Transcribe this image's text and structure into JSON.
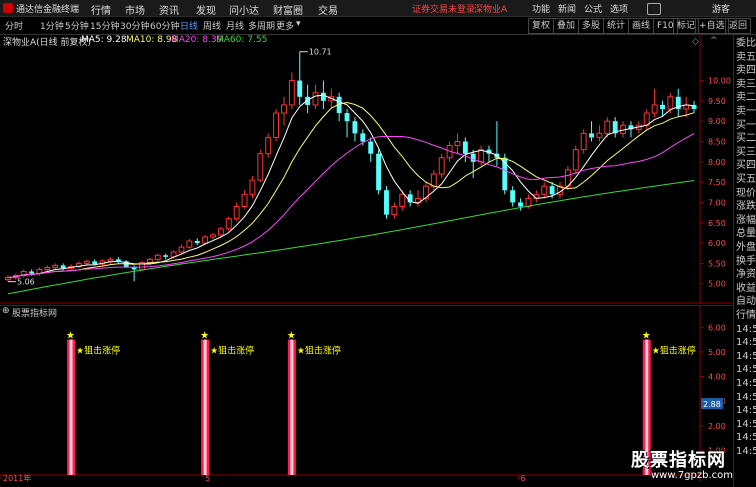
{
  "titlebar": {
    "app_name": "通达信金融终端",
    "menus": [
      "行情",
      "市场",
      "资讯",
      "发现",
      "问小达",
      "财富圈",
      "交易"
    ],
    "warning": "证券交易未登录",
    "stock": "深物业A",
    "right_items": [
      "功能",
      "新闻",
      "公式",
      "选项",
      "游客"
    ]
  },
  "toolbar": {
    "periods": [
      "分时",
      "1分钟",
      "5分钟",
      "15分钟",
      "30分钟",
      "60分钟",
      "日线",
      "周线",
      "月线",
      "多周期",
      "更多"
    ],
    "active": "日线",
    "right_buttons": [
      "复权",
      "叠加",
      "多股",
      "统计",
      "画线",
      "F10",
      "标记",
      "+自选",
      "返回"
    ]
  },
  "legend": {
    "title": "深物业A(日线 前复权)",
    "ma": [
      {
        "label": "MA5: 9.28",
        "color": "#ffffff"
      },
      {
        "label": "MA10: 8.98",
        "color": "#ffff66"
      },
      {
        "label": "MA20: 8.39",
        "color": "#ff44ff"
      },
      {
        "label": "MA60: 7.55",
        "color": "#33dd33"
      }
    ]
  },
  "price_axis": {
    "labels": [
      "10.00",
      "9.50",
      "9.00",
      "8.50",
      "8.00",
      "7.50",
      "7.00",
      "6.50",
      "6.00",
      "5.50",
      "5.00"
    ],
    "values": [
      10.0,
      9.5,
      9.0,
      8.5,
      8.0,
      7.5,
      7.0,
      6.5,
      6.0,
      5.5,
      5.0
    ]
  },
  "annotations": {
    "high": "10.71",
    "low": "5.06"
  },
  "chart_data": {
    "type": "candlestick",
    "ylim": [
      4.5,
      10.9
    ],
    "candles": [
      [
        5.1,
        5.15,
        5.05,
        5.2
      ],
      [
        5.15,
        5.2,
        5.1,
        5.25
      ],
      [
        5.2,
        5.3,
        5.15,
        5.35
      ],
      [
        5.3,
        5.25,
        5.2,
        5.35
      ],
      [
        5.25,
        5.35,
        5.2,
        5.4
      ],
      [
        5.35,
        5.4,
        5.28,
        5.45
      ],
      [
        5.4,
        5.45,
        5.35,
        5.5
      ],
      [
        5.45,
        5.38,
        5.33,
        5.5
      ],
      [
        5.38,
        5.42,
        5.3,
        5.48
      ],
      [
        5.42,
        5.5,
        5.38,
        5.55
      ],
      [
        5.5,
        5.55,
        5.45,
        5.6
      ],
      [
        5.55,
        5.48,
        5.44,
        5.6
      ],
      [
        5.48,
        5.56,
        5.44,
        5.6
      ],
      [
        5.56,
        5.6,
        5.5,
        5.65
      ],
      [
        5.6,
        5.55,
        5.5,
        5.66
      ],
      [
        5.55,
        5.4,
        5.38,
        5.58
      ],
      [
        5.4,
        5.35,
        5.06,
        5.45
      ],
      [
        5.35,
        5.52,
        5.33,
        5.56
      ],
      [
        5.52,
        5.6,
        5.48,
        5.64
      ],
      [
        5.6,
        5.7,
        5.56,
        5.74
      ],
      [
        5.7,
        5.66,
        5.6,
        5.74
      ],
      [
        5.66,
        5.78,
        5.62,
        5.82
      ],
      [
        5.78,
        5.9,
        5.74,
        5.96
      ],
      [
        5.9,
        6.05,
        5.86,
        6.1
      ],
      [
        6.05,
        6.0,
        5.95,
        6.12
      ],
      [
        6.0,
        6.15,
        5.96,
        6.2
      ],
      [
        6.15,
        6.2,
        6.08,
        6.25
      ],
      [
        6.2,
        6.35,
        6.15,
        6.4
      ],
      [
        6.35,
        6.6,
        6.3,
        6.65
      ],
      [
        6.6,
        6.9,
        6.55,
        7.0
      ],
      [
        6.9,
        7.2,
        6.85,
        7.3
      ],
      [
        7.2,
        7.55,
        7.1,
        7.65
      ],
      [
        7.55,
        8.2,
        7.5,
        8.3
      ],
      [
        8.2,
        8.6,
        8.1,
        8.7
      ],
      [
        8.6,
        9.2,
        8.5,
        9.3
      ],
      [
        9.2,
        9.4,
        8.9,
        9.6
      ],
      [
        9.4,
        10.0,
        9.3,
        10.2
      ],
      [
        10.0,
        9.6,
        9.4,
        10.71
      ],
      [
        9.6,
        9.4,
        9.2,
        9.9
      ],
      [
        9.4,
        9.7,
        9.3,
        9.9
      ],
      [
        9.7,
        9.5,
        9.3,
        10.0
      ],
      [
        9.5,
        9.6,
        9.3,
        9.8
      ],
      [
        9.6,
        9.2,
        9.0,
        9.7
      ],
      [
        9.2,
        9.0,
        8.6,
        9.3
      ],
      [
        9.0,
        8.7,
        8.5,
        9.1
      ],
      [
        8.7,
        8.5,
        8.4,
        8.8
      ],
      [
        8.5,
        8.2,
        8.0,
        8.6
      ],
      [
        8.2,
        7.3,
        7.2,
        8.3
      ],
      [
        7.3,
        6.7,
        6.6,
        7.4
      ],
      [
        6.7,
        6.9,
        6.6,
        7.0
      ],
      [
        6.9,
        7.2,
        6.8,
        7.3
      ],
      [
        7.2,
        7.0,
        6.9,
        7.3
      ],
      [
        7.0,
        7.1,
        6.9,
        7.3
      ],
      [
        7.1,
        7.4,
        7.0,
        7.5
      ],
      [
        7.4,
        7.7,
        7.3,
        7.8
      ],
      [
        7.7,
        8.1,
        7.6,
        8.2
      ],
      [
        8.1,
        8.4,
        8.0,
        8.5
      ],
      [
        8.4,
        8.5,
        8.2,
        8.7
      ],
      [
        8.5,
        8.2,
        8.0,
        8.6
      ],
      [
        8.2,
        8.0,
        7.6,
        8.3
      ],
      [
        8.0,
        8.3,
        7.9,
        8.4
      ],
      [
        8.3,
        8.2,
        8.0,
        8.4
      ],
      [
        8.2,
        8.1,
        7.9,
        9.0
      ],
      [
        8.1,
        7.3,
        7.2,
        8.2
      ],
      [
        7.3,
        7.0,
        6.9,
        7.4
      ],
      [
        7.0,
        6.9,
        6.8,
        7.1
      ],
      [
        6.9,
        7.1,
        6.85,
        7.2
      ],
      [
        7.1,
        7.2,
        7.0,
        7.3
      ],
      [
        7.2,
        7.4,
        7.1,
        7.5
      ],
      [
        7.4,
        7.2,
        7.1,
        7.5
      ],
      [
        7.2,
        7.4,
        7.1,
        7.5
      ],
      [
        7.4,
        7.8,
        7.3,
        7.9
      ],
      [
        7.8,
        8.3,
        7.7,
        8.4
      ],
      [
        8.3,
        8.7,
        8.2,
        8.8
      ],
      [
        8.7,
        8.6,
        8.5,
        9.0
      ],
      [
        8.6,
        8.7,
        8.5,
        8.9
      ],
      [
        8.7,
        9.0,
        8.6,
        9.1
      ],
      [
        9.0,
        8.7,
        8.6,
        9.1
      ],
      [
        8.7,
        8.9,
        8.6,
        9.0
      ],
      [
        8.9,
        8.8,
        8.6,
        9.0
      ],
      [
        8.8,
        8.9,
        8.7,
        9.0
      ],
      [
        8.9,
        9.2,
        8.8,
        9.3
      ],
      [
        9.2,
        9.4,
        9.1,
        9.8
      ],
      [
        9.4,
        9.3,
        9.1,
        9.5
      ],
      [
        9.3,
        9.6,
        9.2,
        9.7
      ],
      [
        9.6,
        9.3,
        9.1,
        9.8
      ],
      [
        9.3,
        9.4,
        9.1,
        9.6
      ],
      [
        9.4,
        9.3,
        9.2,
        9.5
      ]
    ]
  },
  "indicator": {
    "title": "股票指标网",
    "signal_label": "狙击涨停",
    "marker_glyph": "★",
    "signal_bars": [
      8,
      25,
      36,
      81,
      100
    ],
    "axis_labels": [
      "6.00",
      "5.00",
      "4.00",
      "3.00",
      "2.00",
      "1.00"
    ],
    "axis_values": [
      6,
      5,
      4,
      3,
      2,
      1
    ],
    "current_value": "2.88",
    "ylim": [
      0,
      6.5
    ]
  },
  "date_axis": [
    "2011年",
    "5",
    "6",
    "7"
  ],
  "right_panel": [
    "委比",
    "卖五",
    "卖四",
    "卖三",
    "卖二",
    "卖一",
    "买一",
    "买二",
    "买三",
    "买四",
    "买五",
    "现价",
    "涨跌",
    "涨幅",
    "总量",
    "外盘",
    "换手",
    "净资",
    "收益",
    "自动",
    "行情",
    "14:5",
    "14:5",
    "14:5",
    "14:5",
    "14:5",
    "14:5",
    "14:5",
    "14:5",
    "14:5",
    "14:5"
  ],
  "watermark": {
    "name": "股票指标网",
    "url": "www.7gpzb.com"
  }
}
